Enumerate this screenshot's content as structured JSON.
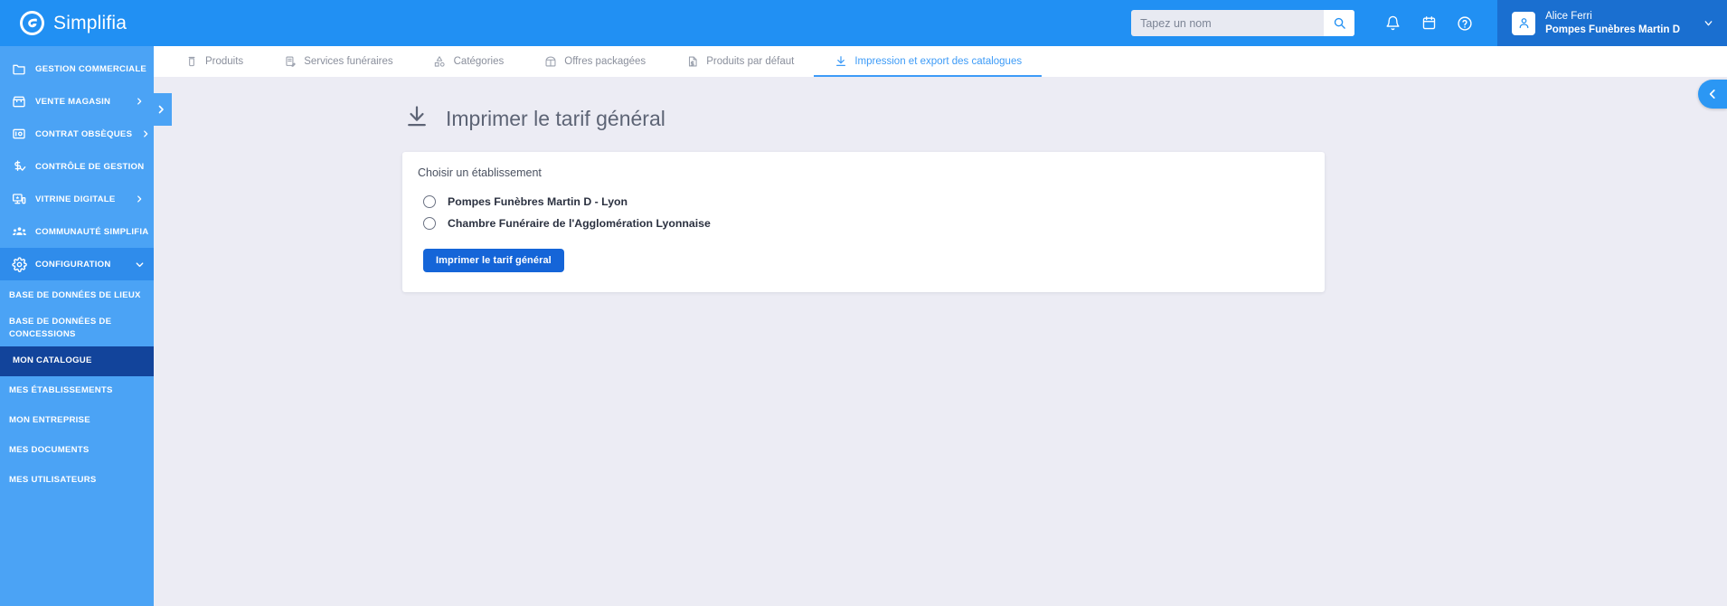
{
  "header": {
    "brand": "Simplifia",
    "logo_icon": "simplifia-logo",
    "search": {
      "placeholder": "Tapez un nom",
      "value": "",
      "icon": "search-icon"
    },
    "icons": [
      {
        "name": "notifications-icon",
        "label": "bell"
      },
      {
        "name": "calendar-icon",
        "label": "calendar"
      },
      {
        "name": "help-icon",
        "label": "question-circle"
      }
    ],
    "profile": {
      "avatar_icon": "user-avatar-icon",
      "name": "Alice Ferri",
      "organization": "Pompes Funèbres Martin D",
      "caret_icon": "chevron-down-icon"
    }
  },
  "sidebar": {
    "toggle_icon": "chevron-right-icon",
    "items": [
      {
        "label": "GESTION COMMERCIALE",
        "icon": "folder-icon",
        "chevron": "chevron-right-icon",
        "active": false
      },
      {
        "label": "VENTE MAGASIN",
        "icon": "store-icon",
        "chevron": "chevron-right-icon",
        "active": false
      },
      {
        "label": "CONTRAT OBSÈQUES",
        "icon": "contract-icon",
        "chevron": "chevron-right-icon",
        "active": false
      },
      {
        "label": "CONTRÔLE DE GESTION",
        "icon": "finance-check-icon",
        "chevron": "chevron-right-icon",
        "active": false
      },
      {
        "label": "VITRINE DIGITALE",
        "icon": "digital-display-icon",
        "chevron": "chevron-right-icon",
        "active": false
      },
      {
        "label": "COMMUNAUTÉ SIMPLIFIA",
        "icon": "community-icon",
        "chevron": "chevron-right-icon",
        "active": false
      },
      {
        "label": "CONFIGURATION",
        "icon": "gear-icon",
        "chevron": "chevron-down-icon",
        "active": true
      }
    ],
    "sub_items": [
      {
        "label": "BASE DE DONNÉES DE LIEUX",
        "active": false
      },
      {
        "label": "BASE DE DONNÉES DE CONCESSIONS",
        "active": false
      },
      {
        "label": "MON CATALOGUE",
        "active": true
      },
      {
        "label": "MES ÉTABLISSEMENTS",
        "active": false
      },
      {
        "label": "MON ENTREPRISE",
        "active": false
      },
      {
        "label": "MES DOCUMENTS",
        "active": false
      },
      {
        "label": "MES UTILISATEURS",
        "active": false
      }
    ]
  },
  "tabs": [
    {
      "label": "Produits",
      "icon": "coffin-icon",
      "active": false
    },
    {
      "label": "Services funéraires",
      "icon": "service-edit-icon",
      "active": false
    },
    {
      "label": "Catégories",
      "icon": "categories-icon",
      "active": false
    },
    {
      "label": "Offres packagées",
      "icon": "package-gift-icon",
      "active": false
    },
    {
      "label": "Produits par défaut",
      "icon": "default-price-doc-icon",
      "active": false
    },
    {
      "label": "Impression et export des catalogues",
      "icon": "download-icon",
      "active": true
    }
  ],
  "main": {
    "page_title": "Imprimer le tarif général",
    "page_title_icon": "download-icon",
    "card": {
      "legend": "Choisir un établissement",
      "options": [
        {
          "label": "Pompes Funèbres Martin D - Lyon",
          "selected": false
        },
        {
          "label": "Chambre Funéraire de l'Agglomération Lyonnaise",
          "selected": false
        }
      ],
      "submit_label": "Imprimer le tarif général"
    }
  },
  "right_panel": {
    "collapse_icon": "chevron-left-icon"
  },
  "colors": {
    "header_blue": "#2190F3",
    "sidebar_blue": "#4BA3F5",
    "sidebar_active": "#12449B",
    "sidebar_group_active": "#2F8CEB",
    "profile_blue": "#1A6FD0",
    "accent_blue": "#3D9BF7",
    "button_blue": "#1565D8",
    "page_bg": "#ECECF4",
    "card_bg": "#FFFFFF"
  }
}
